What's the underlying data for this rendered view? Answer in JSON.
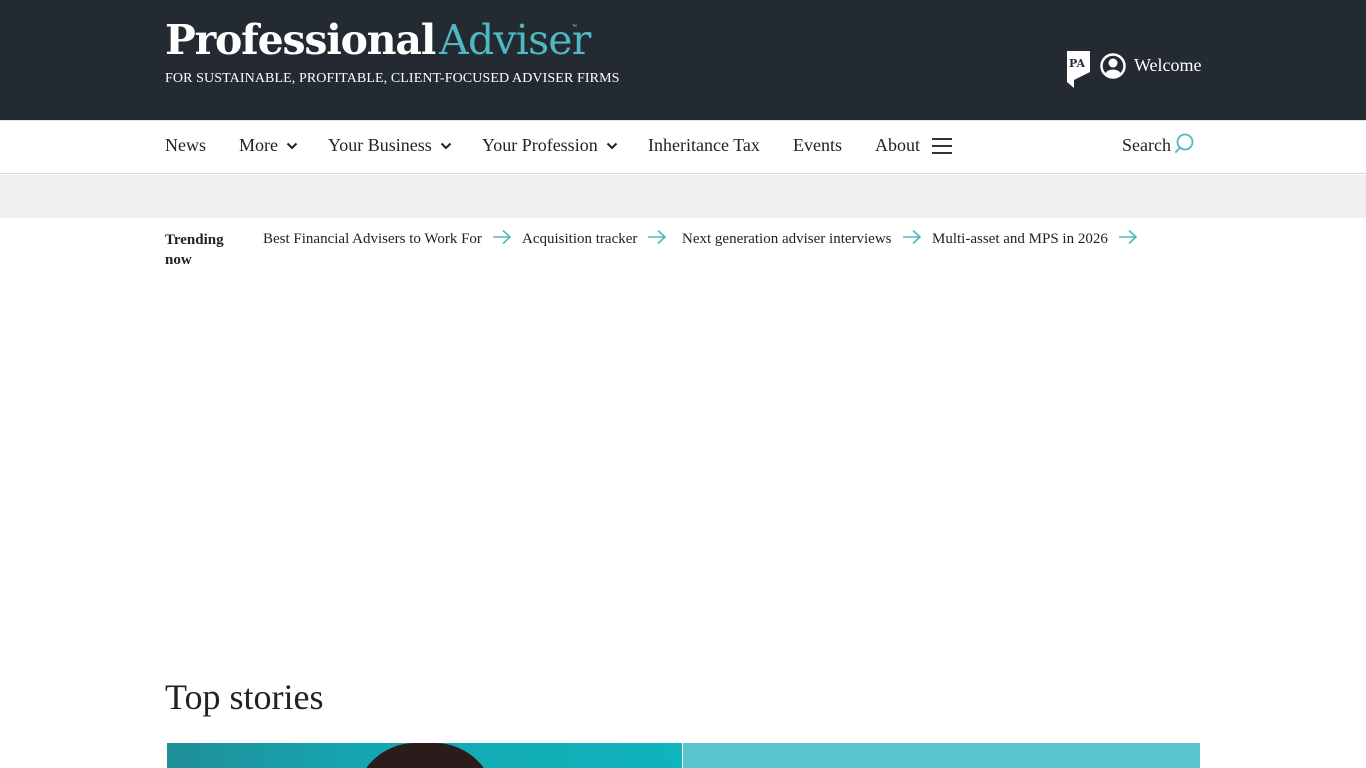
{
  "header": {
    "logo_part1": "Professional",
    "logo_part2": "Adviser",
    "logo_tm": "™",
    "tagline": "FOR SUSTAINABLE, PROFITABLE, CLIENT-FOCUSED ADVISER FIRMS",
    "badge_text": "PA",
    "welcome": "Welcome"
  },
  "nav": {
    "items": [
      {
        "label": "News",
        "dropdown": false
      },
      {
        "label": "More",
        "dropdown": true
      },
      {
        "label": "Your Business",
        "dropdown": true
      },
      {
        "label": "Your Profession",
        "dropdown": true
      },
      {
        "label": "Inheritance Tax",
        "dropdown": false
      },
      {
        "label": "Events",
        "dropdown": false
      },
      {
        "label": "About",
        "dropdown": false
      }
    ],
    "search_label": "Search"
  },
  "trending": {
    "label": "Trending now",
    "items": [
      "Best Financial Advisers to Work For",
      "Acquisition tracker",
      "Next generation adviser interviews",
      "Multi-asset and MPS in 2026"
    ]
  },
  "main": {
    "section_title": "Top stories"
  },
  "colors": {
    "header_bg": "#242a32",
    "accent": "#4fb8c0",
    "ad_strip": "#f0f0f0"
  }
}
